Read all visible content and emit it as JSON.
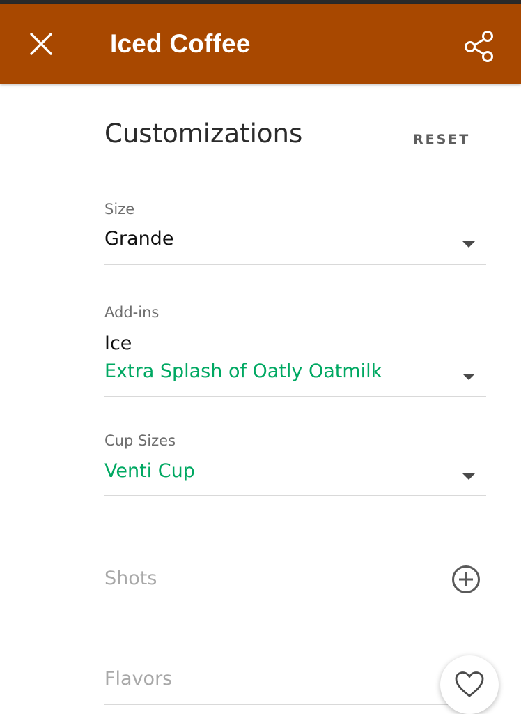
{
  "appbar": {
    "title": "Iced Coffee",
    "close_icon": "close-icon",
    "share_icon": "share-icon",
    "color": "#a84800"
  },
  "customizations": {
    "title": "Customizations",
    "reset_label": "RESET"
  },
  "fields": {
    "size": {
      "label": "Size",
      "value": "Grande"
    },
    "addins": {
      "label": "Add-ins",
      "value_primary": "Ice",
      "value_secondary": "Extra Splash of Oatly Oatmilk"
    },
    "cup_sizes": {
      "label": "Cup Sizes",
      "value": "Venti Cup"
    }
  },
  "sections": {
    "shots": {
      "label": "Shots",
      "icon": "plus-circle-icon"
    },
    "flavors": {
      "label": "Flavors"
    }
  },
  "fab": {
    "icon": "heart-icon"
  },
  "colors": {
    "accent_green": "#00a862",
    "appbar": "#a84800"
  }
}
